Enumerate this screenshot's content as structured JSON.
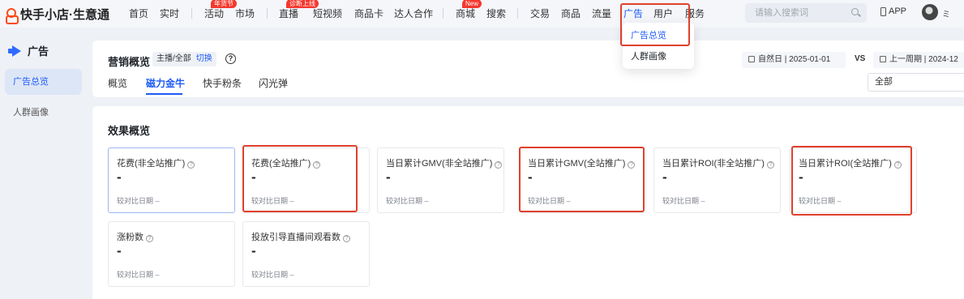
{
  "app": {
    "logo_text": "快手小店·生意通",
    "nav": [
      {
        "label": "首页"
      },
      {
        "label": "实时"
      },
      {
        "label": "活动",
        "badge": "年货节"
      },
      {
        "label": "市场"
      },
      {
        "label": "直播",
        "badge": "诊断上线"
      },
      {
        "label": "短视频"
      },
      {
        "label": "商品卡"
      },
      {
        "label": "达人合作"
      },
      {
        "label": "商城",
        "badge": "New"
      },
      {
        "label": "搜索"
      },
      {
        "label": "交易"
      },
      {
        "label": "商品"
      },
      {
        "label": "流量"
      },
      {
        "label": "广告"
      },
      {
        "label": "用户"
      },
      {
        "label": "服务"
      }
    ],
    "search_placeholder": "请输入搜索词",
    "app_label": "APP",
    "user_short": "ミ",
    "accent_color": "#1f5cf5",
    "annotation_color": "#e0402c"
  },
  "dropdown": {
    "items": [
      {
        "label": "广告总览"
      },
      {
        "label": "人群画像"
      }
    ]
  },
  "sidebar": {
    "title": "广告",
    "items": [
      {
        "label": "广告总览"
      },
      {
        "label": "人群画像"
      }
    ]
  },
  "header": {
    "title": "营销概览",
    "role": "主播/全部",
    "switch_label": "切换",
    "help": "?",
    "tabs": [
      {
        "label": "概览"
      },
      {
        "label": "磁力金牛"
      },
      {
        "label": "快手粉条"
      },
      {
        "label": "闪光弹"
      }
    ],
    "date_type": "自然日",
    "date_value": "2025-01-01",
    "vs": "VS",
    "compare_type": "上一周期",
    "compare_value": "2024-12",
    "filter_value": "全部"
  },
  "overview": {
    "title": "效果概览",
    "cards": [
      {
        "title": "花费(非全站推广)",
        "value": "-",
        "compare": "较对比日期 –"
      },
      {
        "title": "花费(全站推广)",
        "value": "-",
        "compare": "较对比日期 –"
      },
      {
        "title": "当日累计GMV(非全站推广)",
        "value": "-",
        "compare": "较对比日期 –"
      },
      {
        "title": "当日累计GMV(全站推广)",
        "value": "-",
        "compare": "较对比日期 –"
      },
      {
        "title": "当日累计ROI(非全站推广)",
        "value": "-",
        "compare": "较对比日期 –"
      },
      {
        "title": "当日累计ROI(全站推广)",
        "value": "-",
        "compare": "较对比日期 –"
      },
      {
        "title": "涨粉数",
        "value": "-",
        "compare": "较对比日期 –"
      },
      {
        "title": "投放引导直播间观看数",
        "value": "-",
        "compare": "较对比日期 –"
      }
    ]
  }
}
